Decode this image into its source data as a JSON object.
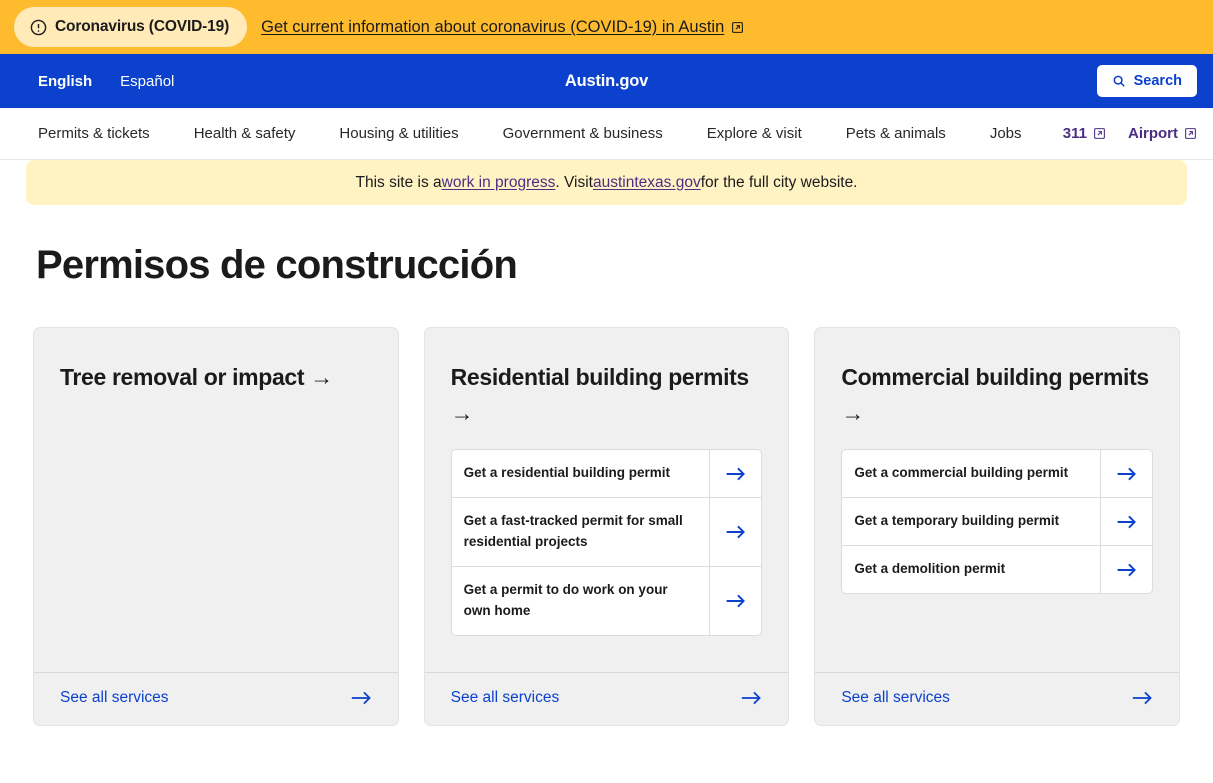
{
  "alert": {
    "badge_label": "Coronavirus (COVID-19)",
    "badge_icon": "warning-circle-icon",
    "link_text": "Get current information about coronavirus (COVID-19) in Austin",
    "link_icon": "external-link-icon",
    "bg_color": "#ffbb2e",
    "pill_color": "#ffeab8"
  },
  "utility": {
    "languages": [
      {
        "label": "English",
        "active": true
      },
      {
        "label": "Español",
        "active": false
      }
    ],
    "brand": "Austin.gov",
    "search_label": "Search",
    "search_icon": "search-icon",
    "bg_color": "#0b41cd"
  },
  "nav": {
    "items": [
      {
        "label": "Permits & tickets"
      },
      {
        "label": "Health & safety"
      },
      {
        "label": "Housing & utilities"
      },
      {
        "label": "Government & business"
      },
      {
        "label": "Explore & visit"
      },
      {
        "label": "Pets & animals"
      },
      {
        "label": "Jobs"
      }
    ],
    "external": [
      {
        "label": "311",
        "icon": "external-link-icon",
        "bold": true
      },
      {
        "label": "Airport",
        "icon": "external-link-icon",
        "bold": true
      }
    ],
    "link_color": "#4b2e83"
  },
  "notice": {
    "text_before": "This site is a ",
    "link1": "work in progress",
    "text_middle": ". Visit ",
    "link2": "austintexas.gov",
    "text_after": " for the full city website.",
    "bg_color": "#fff3c4"
  },
  "page": {
    "title": "Permisos de construcción"
  },
  "cards": [
    {
      "title": "Tree removal or impact",
      "title_arrow": "→",
      "services": [],
      "footer_label": "See all services",
      "footer_icon": "arrow-right-icon"
    },
    {
      "title": "Residential building permits",
      "title_arrow": "→",
      "services": [
        {
          "label": "Get a residential building permit",
          "icon": "arrow-right-icon"
        },
        {
          "label": "Get a fast-tracked permit for small residential projects",
          "icon": "arrow-right-icon"
        },
        {
          "label": "Get a permit to do work on your own home",
          "icon": "arrow-right-icon"
        }
      ],
      "footer_label": "See all services",
      "footer_icon": "arrow-right-icon"
    },
    {
      "title": "Commercial building permits",
      "title_arrow": "→",
      "services": [
        {
          "label": "Get a commercial building permit",
          "icon": "arrow-right-icon"
        },
        {
          "label": "Get a temporary building permit",
          "icon": "arrow-right-icon"
        },
        {
          "label": "Get a demolition permit",
          "icon": "arrow-right-icon"
        }
      ],
      "footer_label": "See all services",
      "footer_icon": "arrow-right-icon"
    }
  ],
  "colors": {
    "brand_blue": "#0b41cd",
    "alert_yellow": "#ffbb2e",
    "card_gray": "#f0f0f0"
  }
}
